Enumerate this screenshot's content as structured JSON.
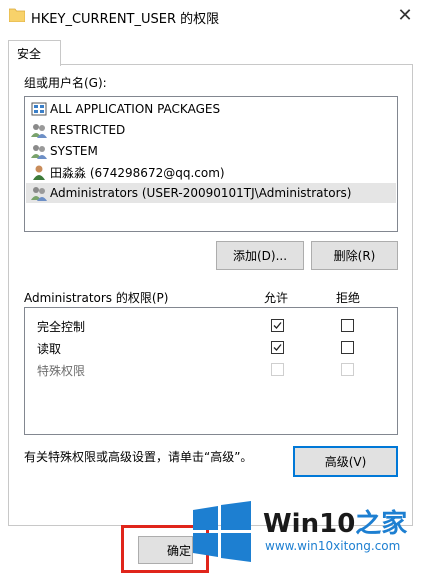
{
  "window": {
    "title": "HKEY_CURRENT_USER 的权限",
    "close": "✕"
  },
  "tabs": [
    {
      "label": "安全"
    }
  ],
  "groups_label": "组或用户名(G):",
  "users": [
    {
      "name": "ALL APPLICATION PACKAGES",
      "icon": "app-packages-icon"
    },
    {
      "name": "RESTRICTED",
      "icon": "group-icon"
    },
    {
      "name": "SYSTEM",
      "icon": "group-icon"
    },
    {
      "name": "田淼淼 (674298672@qq.com)",
      "icon": "user-icon"
    },
    {
      "name": "Administrators (USER-20090101TJ\\Administrators)",
      "icon": "group-icon",
      "selected": true
    }
  ],
  "buttons": {
    "add": "添加(D)...",
    "remove": "删除(R)",
    "advanced": "高级(V)",
    "ok": "确定"
  },
  "perm_header": {
    "title": "Administrators 的权限(P)",
    "allow": "允许",
    "deny": "拒绝"
  },
  "permissions": [
    {
      "name": "完全控制",
      "allow": true,
      "deny": false,
      "disabled": false
    },
    {
      "name": "读取",
      "allow": true,
      "deny": false,
      "disabled": false
    },
    {
      "name": "特殊权限",
      "allow": false,
      "deny": false,
      "disabled": true
    }
  ],
  "advanced_hint": "有关特殊权限或高级设置，请单击“高级”。",
  "watermark": {
    "brand": "Win10",
    "brand_zh": "之家",
    "url": "www.win10xitong.com"
  },
  "colors": {
    "accent": "#0078d7",
    "highlight_box": "#e0251b",
    "selected_row": "#e5e5e5"
  }
}
